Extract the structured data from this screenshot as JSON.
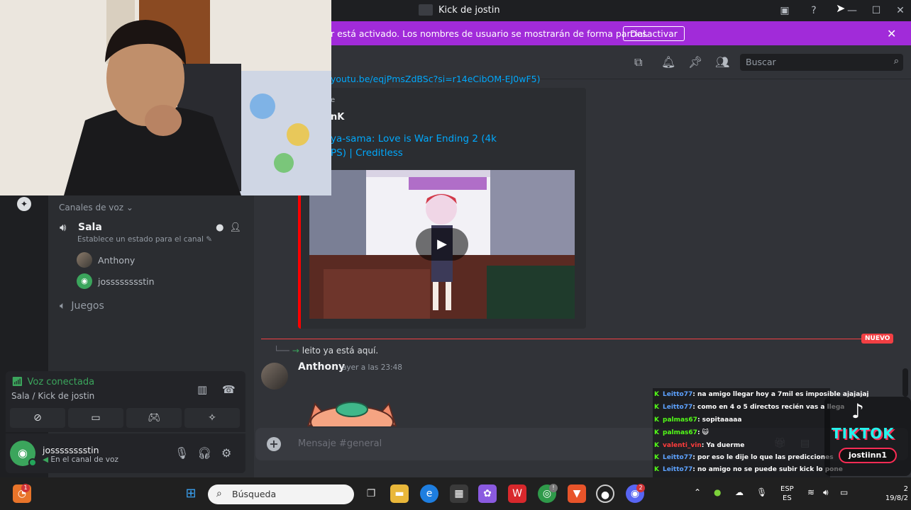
{
  "window": {
    "title": "Kick de jostin"
  },
  "banner": {
    "text": "r está activado. Los nombres de usuario se mostrarán de forma parcial.",
    "button_label": "Desactivar"
  },
  "header": {
    "search_placeholder": "Buscar"
  },
  "sidebar": {
    "category": "Canales de voz",
    "voice_channel": {
      "name": "Sala",
      "status_hint": "Establece un estado para el canal",
      "members": [
        "Anthony",
        "josssssssstin"
      ]
    },
    "voice_channel_2": {
      "name": "Juegos"
    }
  },
  "voice_panel": {
    "title": "Voz conectada",
    "subtitle": "Sala / Kick de jostin"
  },
  "user_panel": {
    "username": "josssssssstin",
    "status": "En el canal de voz"
  },
  "chat": {
    "link_fragment": "youtu.be/eqjPmsZdBSc?si=r14eCibOM-EJ0wF5)",
    "embed": {
      "provider": "e",
      "author": "nK",
      "title": "ya-sama: Love is War Ending 2 (4k\nPS) | Creditless"
    },
    "new_label": "NUEVO",
    "join_text": "leito ya está aquí.",
    "message": {
      "author": "Anthony",
      "timestamp": "ayer a las 23:48"
    },
    "input_placeholder": "Mensaje #general"
  },
  "stream_chat": {
    "lines": [
      {
        "user": "Leitto77",
        "text": "na amigo llegar hoy a 7mil es imposible ajajajaj",
        "color": "u1"
      },
      {
        "user": "Leitto77",
        "text": "como en 4 o 5 directos recién vas a llega",
        "color": "u1"
      },
      {
        "user": "palmas67",
        "text": "sopitaaaaa",
        "color": "u2"
      },
      {
        "user": "palmas67",
        "text": "😺",
        "color": "u2"
      },
      {
        "user": "valenti_vin",
        "text": "Ya duerme",
        "color": "u3"
      },
      {
        "user": "Leitto77",
        "text": "por eso le dije lo que las predicciones",
        "color": "u1"
      },
      {
        "user": "Leitto77",
        "text": "no amigo no se puede subir kick lo pone",
        "color": "u1"
      }
    ]
  },
  "tiktok": {
    "brand": "TIKTOK",
    "user": "jostiinn1"
  },
  "taskbar": {
    "search_placeholder": "Búsqueda",
    "lang_1": "ESP",
    "lang_2": "ES",
    "clock_time": "2",
    "clock_date": "19/8/2"
  },
  "colors": {
    "banner": "#a12bd9",
    "connected": "#3ba55c",
    "new_divider": "#f23f43",
    "link": "#00a8fc"
  }
}
